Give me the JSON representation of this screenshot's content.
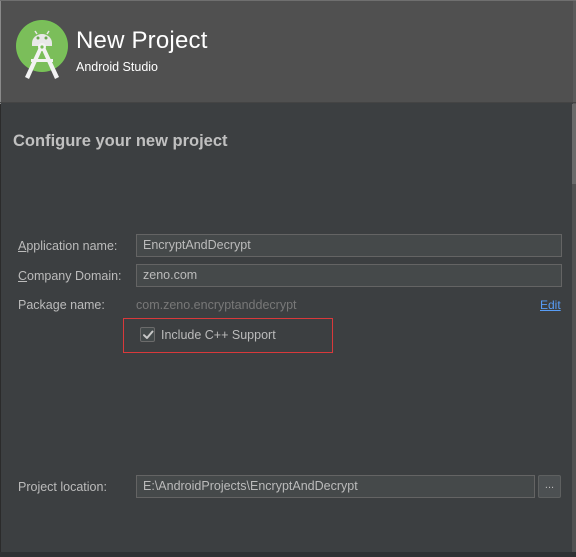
{
  "header": {
    "title": "New Project",
    "subtitle": "Android Studio",
    "logo_icon": "android-studio-logo-icon"
  },
  "section": {
    "title": "Configure your new project"
  },
  "form": {
    "application_name": {
      "label_mnemonic": "A",
      "label_rest": "pplication name:",
      "value": "EncryptAndDecrypt"
    },
    "company_domain": {
      "label_mnemonic": "C",
      "label_rest": "ompany Domain:",
      "value": "zeno.com"
    },
    "package_name": {
      "label": "Package name:",
      "value": "com.zeno.encryptanddecrypt",
      "edit_label": "Edit"
    },
    "include_cpp": {
      "label": "Include C++ Support",
      "checked": true
    },
    "project_location": {
      "label": "Project location:",
      "value": "E:\\AndroidProjects\\EncryptAndDecrypt",
      "browse_label": "..."
    }
  },
  "colors": {
    "background": "#3c3f41",
    "header": "#505050",
    "link": "#589df6",
    "highlight": "#d9393b"
  }
}
